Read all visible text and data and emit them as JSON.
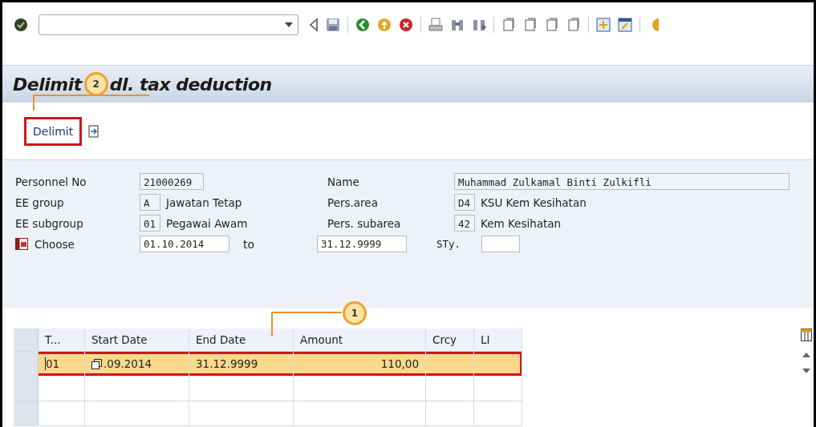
{
  "title": {
    "parts": [
      "Delimit",
      "dl. tax deduction"
    ]
  },
  "callouts": [
    {
      "number": "2"
    },
    {
      "number": "1"
    }
  ],
  "actions": [
    {
      "label": "Delimit",
      "highlighted": true
    }
  ],
  "form": {
    "rows": [
      {
        "label": "Personnel No",
        "value": "21000269",
        "label2": "Name",
        "value2": "Muhammad Zulkamal Binti Zulkifli"
      },
      {
        "label": "EE group",
        "value": "A",
        "text": "Jawatan Tetap",
        "label2": "Pers.area",
        "value2": "D4",
        "text2": "KSU Kem Kesihatan"
      },
      {
        "label": "EE subgroup",
        "value": "01",
        "text": "Pegawai Awam",
        "label2": "Pers. subarea",
        "value2": "42",
        "text2": "Kem Kesihatan"
      }
    ],
    "choose": {
      "label": "Choose",
      "from": "01.10.2014",
      "to_label": "to",
      "to": "31.12.9999",
      "sty_label": "STy."
    }
  },
  "table": {
    "columns": [
      "T...",
      "Start Date",
      "End Date",
      "Amount",
      "Crcy",
      "LI"
    ],
    "rows": [
      {
        "cells": [
          "01",
          ".09.2014",
          "31.12.9999",
          "110,00",
          "",
          ""
        ],
        "selected": true
      }
    ]
  }
}
